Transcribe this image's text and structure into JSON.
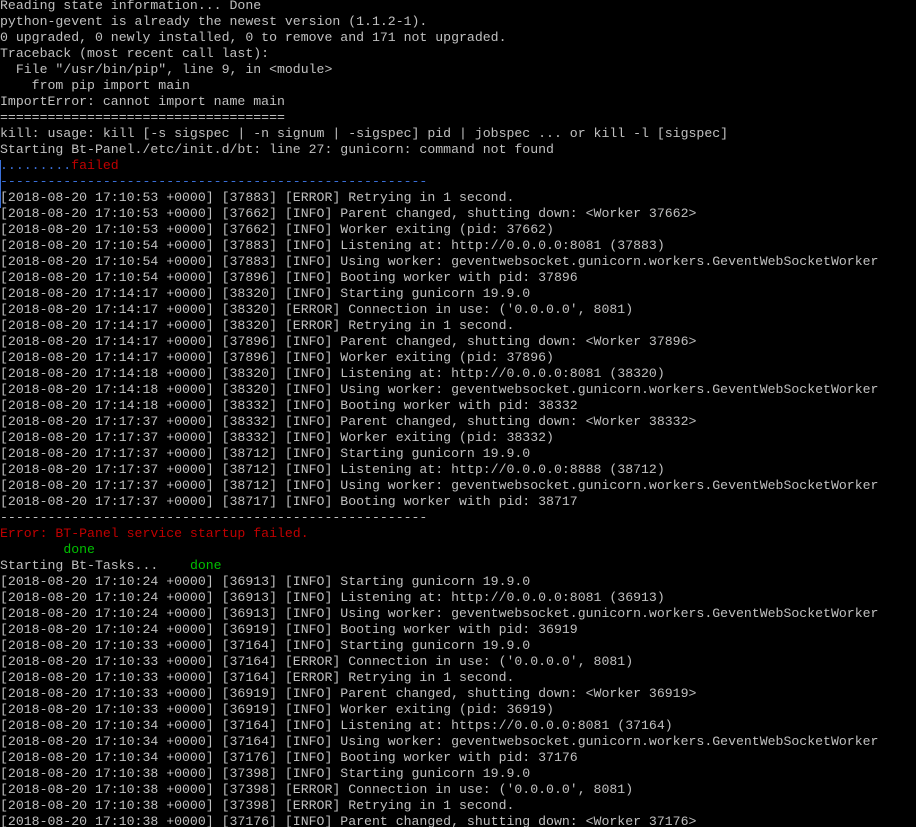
{
  "terminal": {
    "colors": {
      "background": "#000000",
      "default": "#c0c0c0",
      "red": "#c00000",
      "green": "#00c000",
      "blue": "#3a6fd8"
    },
    "lines": [
      [
        {
          "t": "Reading state information... Done"
        }
      ],
      [
        {
          "t": "python-gevent is already the newest version (1.1.2-1)."
        }
      ],
      [
        {
          "t": "0 upgraded, 0 newly installed, 0 to remove and 171 not upgraded."
        }
      ],
      [
        {
          "t": "Traceback (most recent call last):"
        }
      ],
      [
        {
          "t": "  File \"/usr/bin/pip\", line 9, in <module>"
        }
      ],
      [
        {
          "t": "    from pip import main"
        }
      ],
      [
        {
          "t": "ImportError: cannot import name main"
        }
      ],
      [
        {
          "t": "===================================="
        }
      ],
      [
        {
          "t": "kill: usage: kill [-s sigspec | -n signum | -sigspec] pid | jobspec ... or kill -l [sigspec]"
        }
      ],
      [
        {
          "t": "Starting Bt-Panel./etc/init.d/bt: line 27: gunicorn: command not found"
        }
      ],
      [
        {
          "t": ".........",
          "c": "blue"
        },
        {
          "t": "failed",
          "c": "red"
        }
      ],
      [
        {
          "t": "------------------------------------------------------",
          "c": "blue"
        }
      ],
      [
        {
          "t": "[2018-08-20 17:10:53 +0000] [37883] [ERROR] Retrying in 1 second."
        }
      ],
      [
        {
          "t": "[2018-08-20 17:10:53 +0000] [37662] [INFO] Parent changed, shutting down: <Worker 37662>"
        }
      ],
      [
        {
          "t": "[2018-08-20 17:10:53 +0000] [37662] [INFO] Worker exiting (pid: 37662)"
        }
      ],
      [
        {
          "t": "[2018-08-20 17:10:54 +0000] [37883] [INFO] Listening at: http://0.0.0.0:8081 (37883)"
        }
      ],
      [
        {
          "t": "[2018-08-20 17:10:54 +0000] [37883] [INFO] Using worker: geventwebsocket.gunicorn.workers.GeventWebSocketWorker"
        }
      ],
      [
        {
          "t": "[2018-08-20 17:10:54 +0000] [37896] [INFO] Booting worker with pid: 37896"
        }
      ],
      [
        {
          "t": "[2018-08-20 17:14:17 +0000] [38320] [INFO] Starting gunicorn 19.9.0"
        }
      ],
      [
        {
          "t": "[2018-08-20 17:14:17 +0000] [38320] [ERROR] Connection in use: ('0.0.0.0', 8081)"
        }
      ],
      [
        {
          "t": "[2018-08-20 17:14:17 +0000] [38320] [ERROR] Retrying in 1 second."
        }
      ],
      [
        {
          "t": "[2018-08-20 17:14:17 +0000] [37896] [INFO] Parent changed, shutting down: <Worker 37896>"
        }
      ],
      [
        {
          "t": "[2018-08-20 17:14:17 +0000] [37896] [INFO] Worker exiting (pid: 37896)"
        }
      ],
      [
        {
          "t": "[2018-08-20 17:14:18 +0000] [38320] [INFO] Listening at: http://0.0.0.0:8081 (38320)"
        }
      ],
      [
        {
          "t": "[2018-08-20 17:14:18 +0000] [38320] [INFO] Using worker: geventwebsocket.gunicorn.workers.GeventWebSocketWorker"
        }
      ],
      [
        {
          "t": "[2018-08-20 17:14:18 +0000] [38332] [INFO] Booting worker with pid: 38332"
        }
      ],
      [
        {
          "t": "[2018-08-20 17:17:37 +0000] [38332] [INFO] Parent changed, shutting down: <Worker 38332>"
        }
      ],
      [
        {
          "t": "[2018-08-20 17:17:37 +0000] [38332] [INFO] Worker exiting (pid: 38332)"
        }
      ],
      [
        {
          "t": "[2018-08-20 17:17:37 +0000] [38712] [INFO] Starting gunicorn 19.9.0"
        }
      ],
      [
        {
          "t": "[2018-08-20 17:17:37 +0000] [38712] [INFO] Listening at: http://0.0.0.0:8888 (38712)"
        }
      ],
      [
        {
          "t": "[2018-08-20 17:17:37 +0000] [38712] [INFO] Using worker: geventwebsocket.gunicorn.workers.GeventWebSocketWorker"
        }
      ],
      [
        {
          "t": "[2018-08-20 17:17:37 +0000] [38717] [INFO] Booting worker with pid: 38717"
        }
      ],
      [
        {
          "t": "------------------------------------------------------"
        }
      ],
      [
        {
          "t": "Error: BT-Panel service startup failed.",
          "c": "red"
        }
      ],
      [
        {
          "t": "        "
        },
        {
          "t": "done",
          "c": "green"
        }
      ],
      [
        {
          "t": "Starting Bt-Tasks...    "
        },
        {
          "t": "done",
          "c": "green"
        }
      ],
      [
        {
          "t": "[2018-08-20 17:10:24 +0000] [36913] [INFO] Starting gunicorn 19.9.0"
        }
      ],
      [
        {
          "t": "[2018-08-20 17:10:24 +0000] [36913] [INFO] Listening at: http://0.0.0.0:8081 (36913)"
        }
      ],
      [
        {
          "t": "[2018-08-20 17:10:24 +0000] [36913] [INFO] Using worker: geventwebsocket.gunicorn.workers.GeventWebSocketWorker"
        }
      ],
      [
        {
          "t": "[2018-08-20 17:10:24 +0000] [36919] [INFO] Booting worker with pid: 36919"
        }
      ],
      [
        {
          "t": "[2018-08-20 17:10:33 +0000] [37164] [INFO] Starting gunicorn 19.9.0"
        }
      ],
      [
        {
          "t": "[2018-08-20 17:10:33 +0000] [37164] [ERROR] Connection in use: ('0.0.0.0', 8081)"
        }
      ],
      [
        {
          "t": "[2018-08-20 17:10:33 +0000] [37164] [ERROR] Retrying in 1 second."
        }
      ],
      [
        {
          "t": "[2018-08-20 17:10:33 +0000] [36919] [INFO] Parent changed, shutting down: <Worker 36919>"
        }
      ],
      [
        {
          "t": "[2018-08-20 17:10:33 +0000] [36919] [INFO] Worker exiting (pid: 36919)"
        }
      ],
      [
        {
          "t": "[2018-08-20 17:10:34 +0000] [37164] [INFO] Listening at: https://0.0.0.0:8081 (37164)"
        }
      ],
      [
        {
          "t": "[2018-08-20 17:10:34 +0000] [37164] [INFO] Using worker: geventwebsocket.gunicorn.workers.GeventWebSocketWorker"
        }
      ],
      [
        {
          "t": "[2018-08-20 17:10:34 +0000] [37176] [INFO] Booting worker with pid: 37176"
        }
      ],
      [
        {
          "t": "[2018-08-20 17:10:38 +0000] [37398] [INFO] Starting gunicorn 19.9.0"
        }
      ],
      [
        {
          "t": "[2018-08-20 17:10:38 +0000] [37398] [ERROR] Connection in use: ('0.0.0.0', 8081)"
        }
      ],
      [
        {
          "t": "[2018-08-20 17:10:38 +0000] [37398] [ERROR] Retrying in 1 second."
        }
      ],
      [
        {
          "t": "[2018-08-20 17:10:38 +0000] [37176] [INFO] Parent changed, shutting down: <Worker 37176>"
        }
      ]
    ]
  }
}
